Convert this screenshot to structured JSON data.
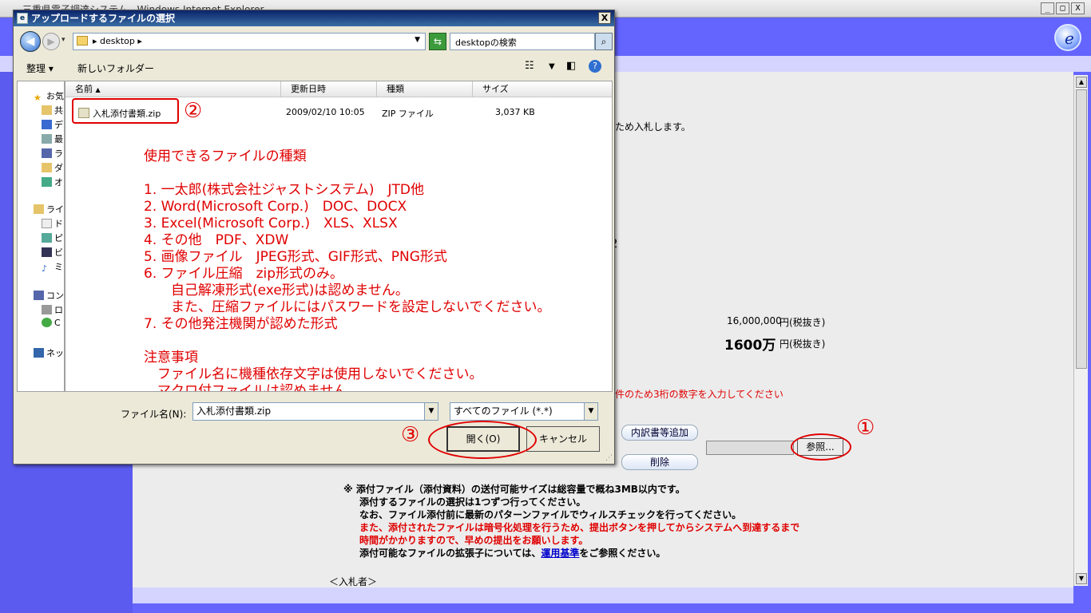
{
  "browser": {
    "title": "三重県電子調達システム - Windows Internet Explorer",
    "min_btn": "_",
    "max_btn": "□",
    "close_btn": "X"
  },
  "page": {
    "bid_text_fragment": "ため入札します。",
    "fragment_2": "2",
    "amount_row1_value": "16,000,000",
    "amount_row1_unit": "円(税抜き)",
    "amount_row2_value": "1600万",
    "amount_row2_unit": "円(税抜き)",
    "red_instruction": "件のため3桁の数字を入力してください",
    "attach_add_button": "内訳書等追加",
    "delete_button": "削除",
    "browse_button": "参照...",
    "notes": {
      "line1": "※ 添付ファイル（添付資料）の送付可能サイズは総容量で概ね3MB以内です。",
      "line2": "添付するファイルの選択は1つずつ行ってください。",
      "line3": "なお、ファイル添付前に最新のパターンファイルでウィルスチェックを行ってください。",
      "line4": "また、添付されたファイルは暗号化処理を行うため、提出ボタンを押してからシステムへ到達するまで",
      "line5": "時間がかかりますので、早めの提出をお願いします。",
      "line6_prefix": "添付可能なファイルの拡張子については、",
      "line6_link": "運用基準",
      "line6_suffix": "をご参照ください。"
    },
    "bidder_label": "＜入札者＞"
  },
  "annotations": {
    "mark1": "①",
    "mark2": "②",
    "mark3": "③"
  },
  "dialog": {
    "title": "アップロードするファイルの選択",
    "close": "X",
    "address_path": "▸ desktop ▸",
    "search_placeholder": "desktopの検索",
    "toolbar": {
      "organize": "整理",
      "new_folder": "新しいフォルダー"
    },
    "nav_items": [
      "お気",
      "共",
      "デ",
      "最",
      "ラ",
      "ダ",
      "オ",
      "ライ",
      "ド",
      "ピ",
      "ビ",
      "ミ",
      "コン",
      "ロ",
      "C",
      "ネッ"
    ],
    "columns": {
      "name": "名前",
      "modified": "更新日時",
      "type": "種類",
      "size": "サイズ"
    },
    "file": {
      "name": "入札添付書類.zip",
      "modified": "2009/02/10 10:05",
      "type": "ZIP ファイル",
      "size": "3,037 KB"
    },
    "note_lines": [
      "使用できるファイルの種類",
      "1. 一太郎(株式会社ジャストシステム)　JTD他",
      "2. Word(Microsoft Corp.)　DOC、DOCX",
      "3. Excel(Microsoft Corp.)　XLS、XLSX",
      "4. その他　PDF、XDW",
      "5. 画像ファイル　JPEG形式、GIF形式、PNG形式",
      "6. ファイル圧縮　zip形式のみ。",
      "　　自己解凍形式(exe形式)は認めません。",
      "　　また、圧縮ファイルにはパスワードを設定しないでください。",
      "7. その他発注機関が認めた形式",
      "注意事項",
      "　ファイル名に機種依存文字は使用しないでください。",
      "　マクロ付ファイルは認めません。"
    ],
    "filename_label": "ファイル名(N):",
    "filename_value": "入札添付書類.zip",
    "filetype_value": "すべてのファイル (*.*)",
    "open_button": "開く(O)",
    "cancel_button": "キャンセル"
  }
}
